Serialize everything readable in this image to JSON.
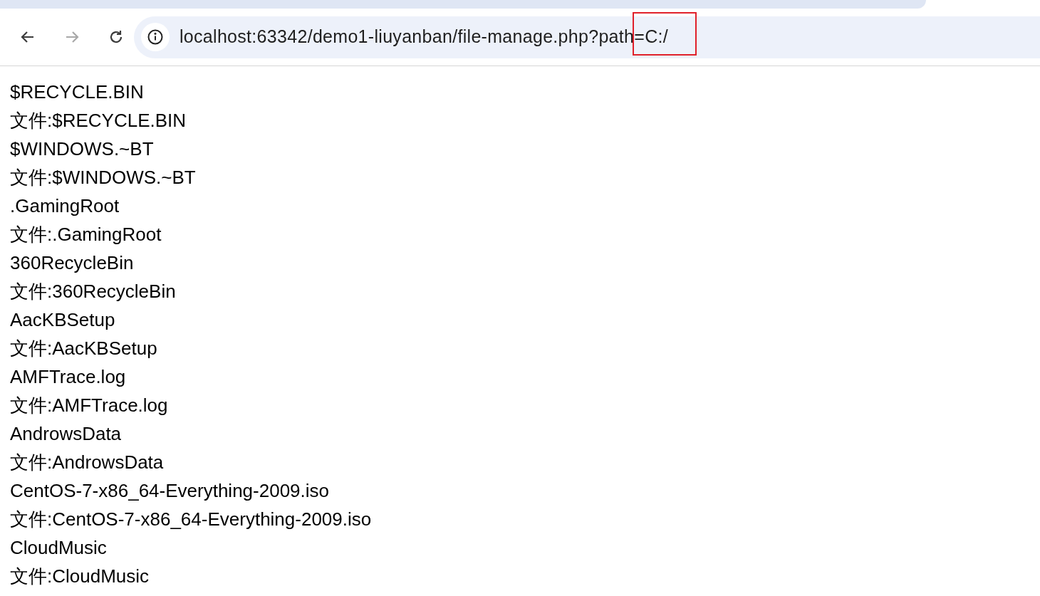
{
  "toolbar": {
    "back": {
      "disabled": false
    },
    "forward": {
      "disabled": true
    },
    "address": "localhost:63342/demo1-liuyanban/file-manage.php?path=C:/"
  },
  "lines": [
    "$RECYCLE.BIN",
    "文件:$RECYCLE.BIN",
    "$WINDOWS.~BT",
    "文件:$WINDOWS.~BT",
    ".GamingRoot",
    "文件:.GamingRoot",
    "360RecycleBin",
    "文件:360RecycleBin",
    "AacKBSetup",
    "文件:AacKBSetup",
    "AMFTrace.log",
    "文件:AMFTrace.log",
    "AndrowsData",
    "文件:AndrowsData",
    "CentOS-7-x86_64-Everything-2009.iso",
    "文件:CentOS-7-x86_64-Everything-2009.iso",
    "CloudMusic",
    "文件:CloudMusic"
  ]
}
